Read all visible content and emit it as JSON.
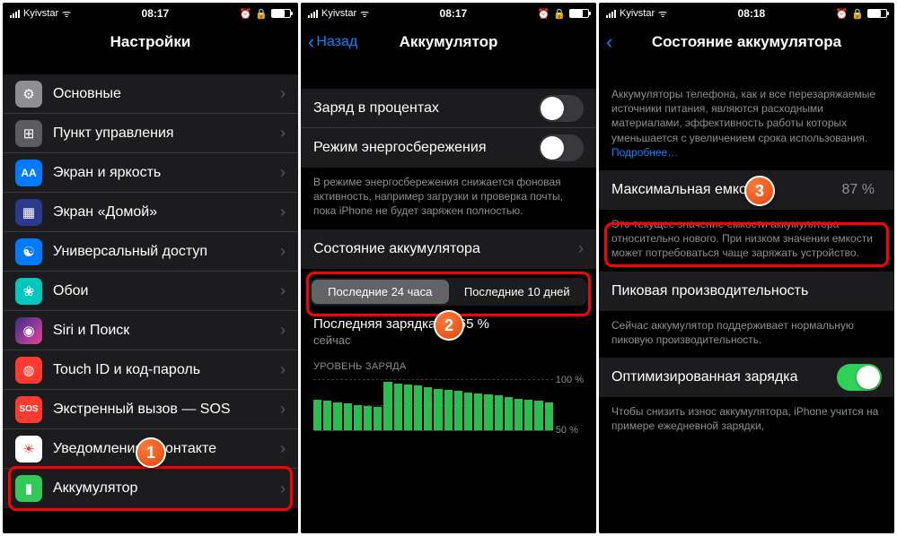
{
  "screens": [
    {
      "status": {
        "carrier": "Kyivstar",
        "time": "08:17"
      },
      "nav": {
        "title": "Настройки"
      },
      "items": [
        {
          "label": "Основные"
        },
        {
          "label": "Пункт управления"
        },
        {
          "label": "Экран и яркость"
        },
        {
          "label": "Экран «Домой»"
        },
        {
          "label": "Универсальный доступ"
        },
        {
          "label": "Обои"
        },
        {
          "label": "Siri и Поиск"
        },
        {
          "label": "Touch ID и код-пароль"
        },
        {
          "label": "Экстренный вызов — SOS"
        },
        {
          "label": "Уведомления о контакте"
        },
        {
          "label": "Аккумулятор"
        }
      ]
    },
    {
      "status": {
        "carrier": "Kyivstar",
        "time": "08:17"
      },
      "nav": {
        "title": "Аккумулятор",
        "back": "Назад"
      },
      "toggles": [
        {
          "label": "Заряд в процентах",
          "on": false
        },
        {
          "label": "Режим энергосбережения",
          "on": false
        }
      ],
      "footer": "В режиме энергосбережения снижается фоновая активность, например загрузки и проверка почты, пока iPhone не будет заряжен полностью.",
      "row_health": "Состояние аккумулятора",
      "seg": [
        "Последние 24 часа",
        "Последние 10 дней"
      ],
      "charge": {
        "title": "Последняя зарядка до 65 %",
        "sub": "сейчас"
      },
      "chart_header": "УРОВЕНЬ ЗАРЯДА",
      "ylabels": [
        "100 %",
        "50 %"
      ]
    },
    {
      "status": {
        "carrier": "Kyivstar",
        "time": "08:18"
      },
      "nav": {
        "title": "Состояние аккумулятора"
      },
      "intro": "Аккумуляторы телефона, как и все перезаряжаемые источники питания, являются расходными материалами, эффективность работы которых уменьшается с увеличением срока использования. ",
      "intro_link": "Подробнее…",
      "capacity": {
        "label": "Максимальная емкость",
        "value": "87 %"
      },
      "capacity_note": "Это текущее значение емкости аккумулятора относительно нового. При низком значении емкости может потребоваться чаще заряжать устройство.",
      "peak": {
        "label": "Пиковая производительность"
      },
      "peak_note": "Сейчас аккумулятор поддерживает нормальную пиковую производительность.",
      "optimized": {
        "label": "Оптимизированная зарядка"
      },
      "optimized_note": "Чтобы снизить износ аккумулятора, iPhone учится на примере ежедневной зарядки,"
    }
  ],
  "chart_data": {
    "type": "bar",
    "title": "УРОВЕНЬ ЗАРЯДА",
    "ylabel": "%",
    "ylim": [
      0,
      100
    ],
    "values": [
      60,
      58,
      55,
      52,
      50,
      48,
      45,
      95,
      92,
      90,
      88,
      85,
      82,
      80,
      78,
      75,
      72,
      70,
      68,
      65,
      62,
      60,
      58,
      55
    ]
  }
}
